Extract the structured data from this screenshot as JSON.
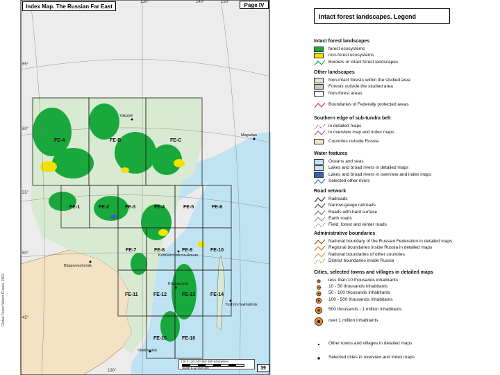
{
  "map": {
    "title": "Index Map. The Russian Far East",
    "page_label": "Page IV",
    "page_number": "39",
    "credit": "Global Forest Watch Russia, 2002",
    "longitude_labels": [
      "130°",
      "140°",
      "150°",
      "130°"
    ],
    "latitude_labels": [
      "65°",
      "60°",
      "55°",
      "50°",
      "45°"
    ],
    "sheets": [
      "FE-A",
      "FE-B",
      "FE-C",
      "FE-1",
      "FE-2",
      "FE-3",
      "FE-4",
      "FE-5",
      "FE-6",
      "FE-7",
      "FE-8",
      "FE-9",
      "FE-10",
      "FE-11",
      "FE-12",
      "FE-13",
      "FE-14",
      "FE-15",
      "FE-16"
    ],
    "cities": [
      "Yakutsk",
      "Magadan",
      "Blagoveschensk",
      "Komsomolsk-na-Amure",
      "Khabarovsk",
      "Yuzhno-Sakhalinsk",
      "Vladivostok"
    ],
    "scale": {
      "ticks": "120 0 120 240 360 480 Kilometers",
      "text": "Scale  1:12 000 000"
    },
    "colors": {
      "sea": "#bfe3f2",
      "foreign_country": "#f3e2c3",
      "non_intact_forest": "#d9ead2",
      "outside_forest": "#e6e6e6",
      "intact_forest": "#18a83c",
      "non_forest_ecosystem": "#f2e200"
    }
  },
  "legend": {
    "title": "Intact forest landscapes. Legend",
    "sections": [
      {
        "heading": "Intact forest landscapes",
        "items": [
          {
            "label": "forest ecosystems",
            "symbol": "swatch",
            "color": "#18a83c"
          },
          {
            "label": "non-forest ecosystems",
            "symbol": "swatch",
            "color": "#f2e200"
          },
          {
            "label": "Borders of intact forest landscapes",
            "symbol": "line",
            "color": "#2a9d3a"
          }
        ]
      },
      {
        "heading": "Other landscapes",
        "items": [
          {
            "label": "Non-intact forests within the studied area",
            "symbol": "swatch",
            "color": "#d9ead2"
          },
          {
            "label": "Forests outside the studied area",
            "symbol": "swatch",
            "color": "#c8c8c8"
          },
          {
            "label": "Non-forest areas",
            "symbol": "swatch",
            "color": "#ffffff"
          }
        ]
      },
      {
        "heading": "",
        "items": [
          {
            "label": "Boundaries of Federally protected areas",
            "symbol": "line",
            "color": "#e03030"
          }
        ]
      },
      {
        "heading": "Southern edge of sub-tundra belt",
        "items": [
          {
            "label": "in detailed maps",
            "symbol": "dots",
            "color": "#b04fb0"
          },
          {
            "label": "in overview map and index maps",
            "symbol": "line",
            "color": "#b04fb0"
          }
        ]
      },
      {
        "heading": "",
        "items": [
          {
            "label": "Countries outside Russia",
            "symbol": "swatch",
            "color": "#f3e2c3"
          }
        ]
      },
      {
        "heading": "Water features",
        "items": [
          {
            "label": "Oceans and seas",
            "symbol": "swatch",
            "color": "#bfe3f2"
          },
          {
            "label": "Lakes and broad rivers in detailed maps",
            "symbol": "swatch",
            "color": "#bfe3f2"
          },
          {
            "label": "Lakes and broad rivers in overview and index maps",
            "symbol": "swatch",
            "color": "#2e66b8"
          },
          {
            "label": "Selected other rivers",
            "symbol": "line",
            "color": "#3a78c8"
          }
        ]
      },
      {
        "heading": "Road network",
        "items": [
          {
            "label": "Railroads",
            "symbol": "line",
            "color": "#333333"
          },
          {
            "label": "Narrow-gauge railroads",
            "symbol": "line",
            "color": "#555555"
          },
          {
            "label": "Roads with hard surface",
            "symbol": "line",
            "color": "#777777"
          },
          {
            "label": "Earth roads",
            "symbol": "line",
            "color": "#999999"
          },
          {
            "label": "Field, forest and winter roads",
            "symbol": "dots",
            "color": "#888888"
          }
        ]
      },
      {
        "heading": "Administrative boundaries",
        "items": [
          {
            "label": "National boundary of the Russian Federation in detailed maps",
            "symbol": "line",
            "color": "#8a5a00"
          },
          {
            "label": "Regional boundaries inside Russia in detailed maps",
            "symbol": "line",
            "color": "#c27b2a"
          },
          {
            "label": "National boundaries of other countries",
            "symbol": "line",
            "color": "#e0a040"
          },
          {
            "label": "District boundaries inside Russia",
            "symbol": "dots",
            "color": "#c27b2a"
          }
        ]
      },
      {
        "heading": "Cities, selected towns and villages in detailed maps",
        "items": [
          {
            "label": "less than 10 thousands inhabitants",
            "symbol": "city",
            "size": 1
          },
          {
            "label": "10 - 50 thousands inhabitants",
            "symbol": "city",
            "size": 2
          },
          {
            "label": "50 - 100 thousands inhabitants",
            "symbol": "city",
            "size": 3
          },
          {
            "label": "100 - 500 thousands inhabitants",
            "symbol": "city",
            "size": 4
          },
          {
            "label": "500 thousands - 1 million inhabitants",
            "symbol": "city",
            "size": 5
          },
          {
            "label": "over 1 million inhabitants",
            "symbol": "city",
            "size": 6
          }
        ]
      },
      {
        "heading": "",
        "items": [
          {
            "label": "Other towns and villages in detailed maps",
            "symbol": "dot-small"
          },
          {
            "label": "Selected cities in overview and index maps",
            "symbol": "dot"
          }
        ]
      }
    ]
  }
}
